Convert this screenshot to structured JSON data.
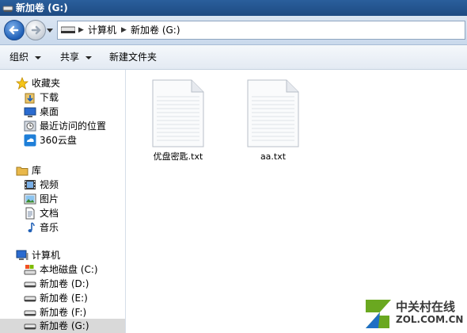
{
  "window": {
    "title": "新加卷 (G:)"
  },
  "address": {
    "crumbs": [
      "计算机",
      "新加卷 (G:)"
    ]
  },
  "toolbar": {
    "organize": "组织",
    "share": "共享",
    "new_folder": "新建文件夹"
  },
  "nav": {
    "favorites": {
      "label": "收藏夹",
      "items": [
        "下载",
        "桌面",
        "最近访问的位置",
        "360云盘"
      ]
    },
    "libraries": {
      "label": "库",
      "items": [
        "视频",
        "图片",
        "文档",
        "音乐"
      ]
    },
    "computer": {
      "label": "计算机",
      "items": [
        "本地磁盘 (C:)",
        "新加卷 (D:)",
        "新加卷 (E:)",
        "新加卷 (F:)",
        "新加卷 (G:)"
      ],
      "selected": "新加卷 (G:)"
    }
  },
  "files": [
    {
      "name": "优盘密匙.txt",
      "icon": "text-file-icon"
    },
    {
      "name": "aa.txt",
      "icon": "text-file-icon"
    }
  ],
  "watermark": {
    "cn": "中关村在线",
    "en": "ZOL.COM.CN"
  },
  "colors": {
    "titlebar": "#1e4b82",
    "selected_nav": "#d9d9d9",
    "watermark_green": "#6aa820",
    "watermark_blue": "#1e6fc4"
  }
}
